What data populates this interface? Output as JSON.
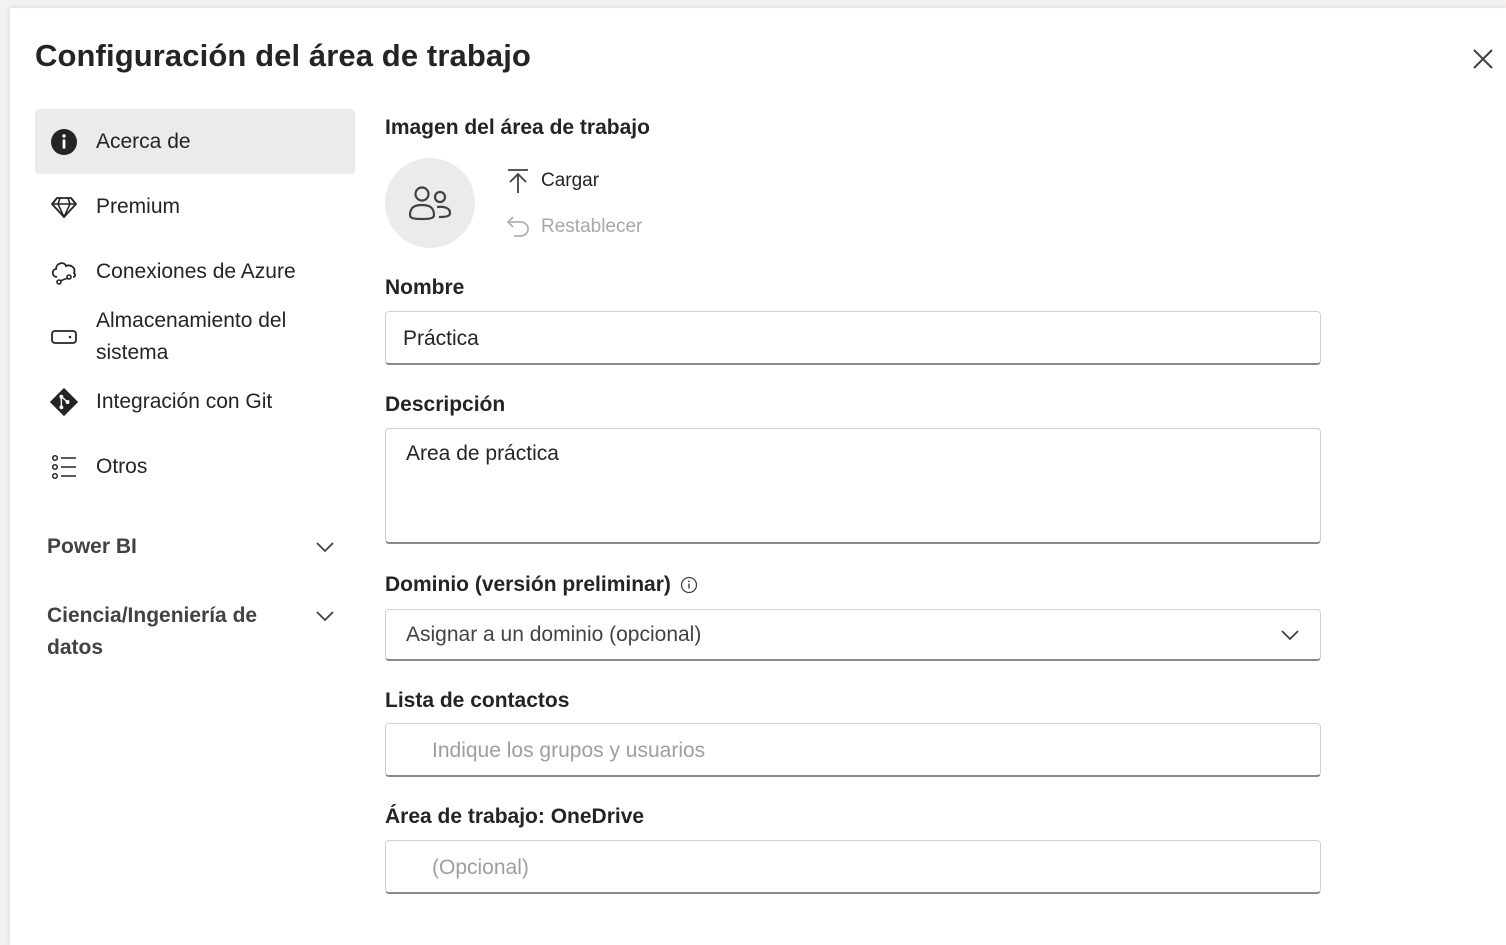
{
  "dialog": {
    "title": "Configuración del área de trabajo",
    "close_icon": "close-icon"
  },
  "sidebar": {
    "items": [
      {
        "label": "Acerca de",
        "icon": "info-icon",
        "active": true
      },
      {
        "label": "Premium",
        "icon": "diamond-icon",
        "active": false
      },
      {
        "label": "Conexiones de Azure",
        "icon": "cloud-link-icon",
        "active": false
      },
      {
        "label": "Almacenamiento del sistema",
        "icon": "storage-icon",
        "active": false
      },
      {
        "label": "Integración con Git",
        "icon": "git-icon",
        "active": false
      },
      {
        "label": "Otros",
        "icon": "list-icon",
        "active": false
      }
    ],
    "sections": [
      {
        "label": "Power BI",
        "icon": "chevron-down-icon"
      },
      {
        "label": "Ciencia/Ingeniería de datos",
        "icon": "chevron-down-icon"
      }
    ]
  },
  "form": {
    "image": {
      "label": "Imagen del área de trabajo",
      "upload_label": "Cargar",
      "reset_label": "Restablecer"
    },
    "name": {
      "label": "Nombre",
      "value": "Práctica"
    },
    "description": {
      "label": "Descripción",
      "value": "Area de práctica"
    },
    "domain": {
      "label": "Dominio (versión preliminar)",
      "selected": "Asignar a un dominio (opcional)"
    },
    "contacts": {
      "label": "Lista de contactos",
      "placeholder": "Indique los grupos y usuarios"
    },
    "onedrive": {
      "label": "Área de trabajo: OneDrive",
      "placeholder": "(Opcional)"
    }
  },
  "colors": {
    "active_nav_bg": "#ebebeb",
    "text": "#242424",
    "placeholder": "#9e9e9e",
    "disabled": "#a8a8a8"
  }
}
